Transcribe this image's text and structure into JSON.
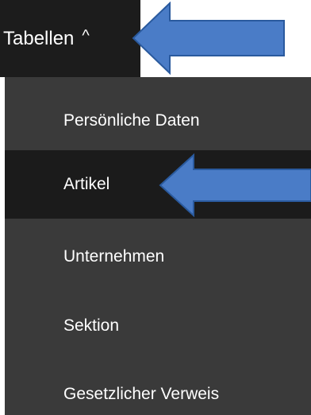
{
  "menu": {
    "title": "Tabellen",
    "caret": "^",
    "items": [
      {
        "label": "Persönliche Daten",
        "active": false
      },
      {
        "label": "Artikel",
        "active": true
      },
      {
        "label": "Unternehmen",
        "active": false
      },
      {
        "label": "Sektion",
        "active": false
      },
      {
        "label": "Gesetzlicher Verweis",
        "active": false
      }
    ]
  },
  "annotations": {
    "arrow_color": "#4a7cc7",
    "arrow_outline": "#2a5a9e",
    "arrows": [
      "arrow-left-icon",
      "arrow-left-icon"
    ]
  },
  "colors": {
    "header_bg": "#1c1c1c",
    "dropdown_bg": "#3a3a3a",
    "active_bg": "#1b1b1b",
    "text": "#ffffff"
  }
}
